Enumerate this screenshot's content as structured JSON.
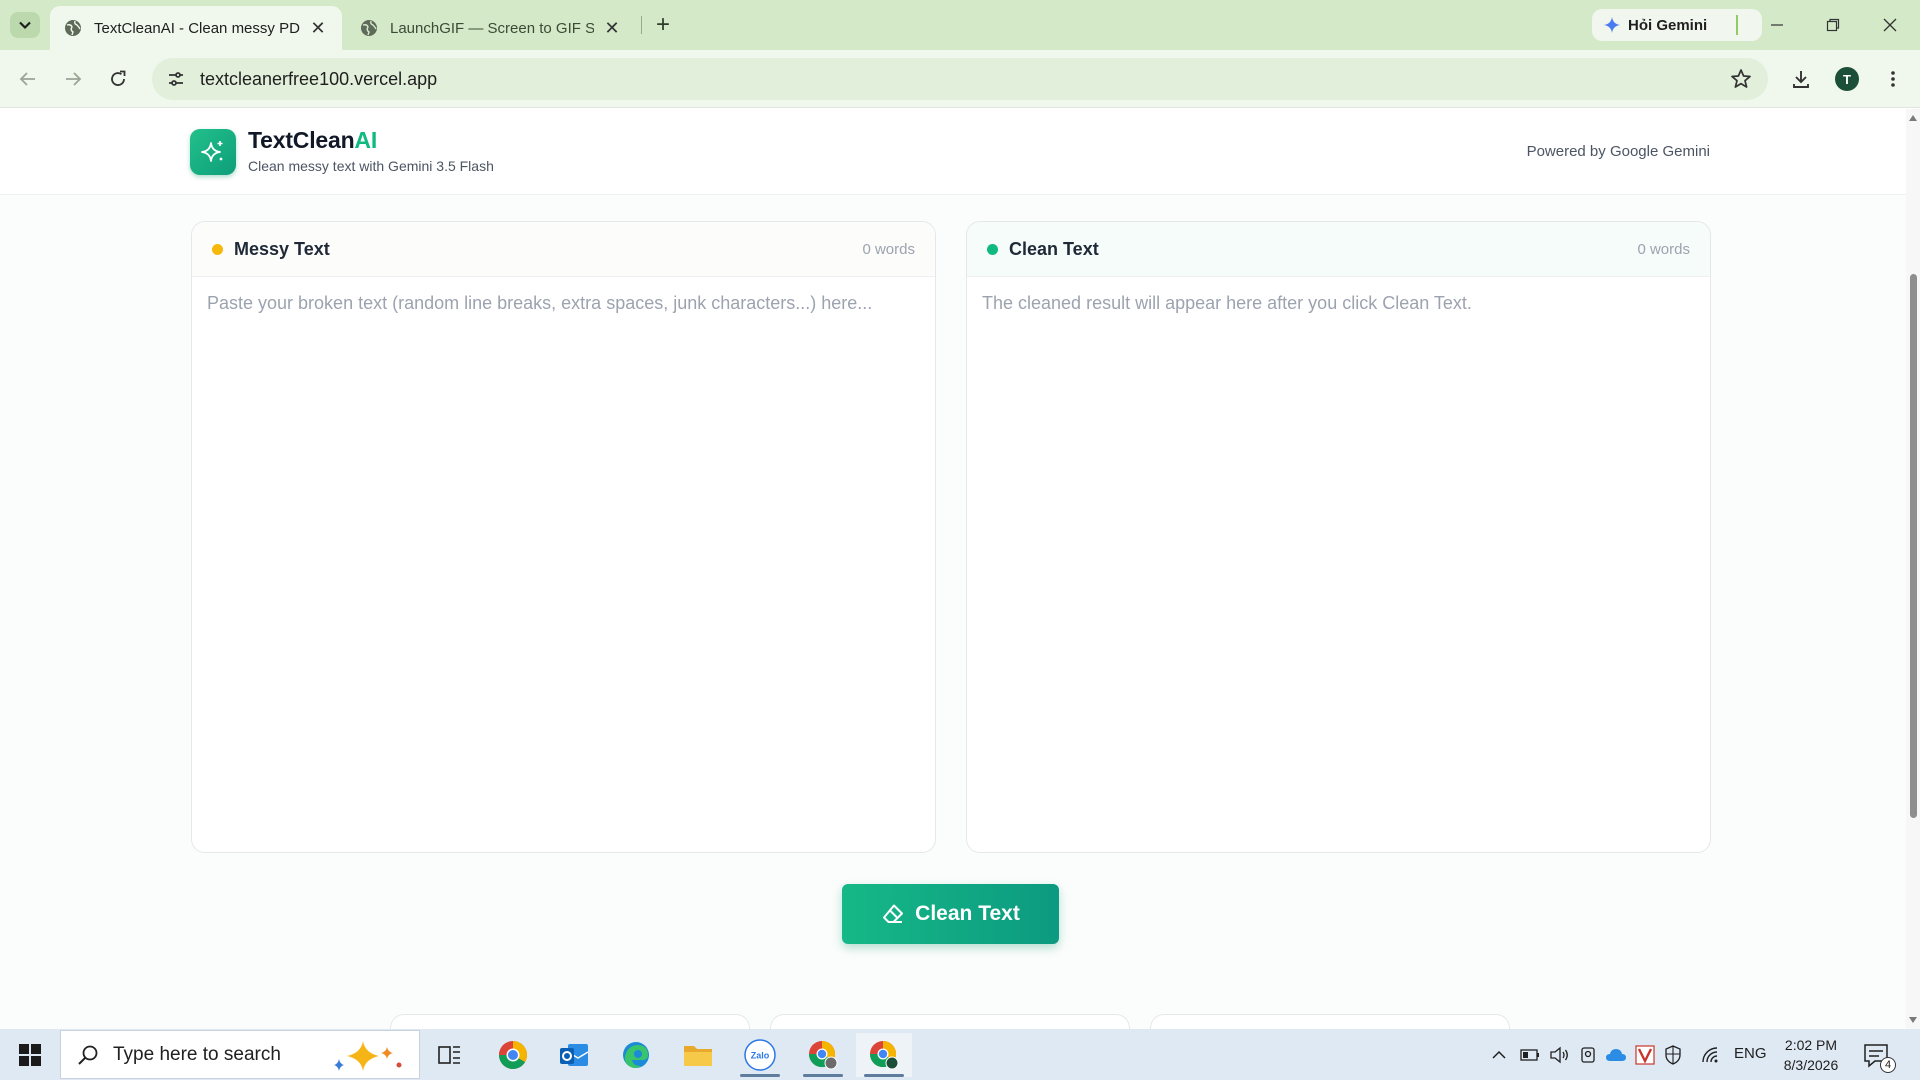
{
  "browser": {
    "tabs": [
      {
        "title": "TextCleanAI - Clean messy PDF",
        "active": true
      },
      {
        "title": "LaunchGIF — Screen to GIF Stu",
        "active": false
      }
    ],
    "gemini_button": "Hỏi Gemini",
    "url": "textcleanerfree100.vercel.app",
    "profile_initial": "T"
  },
  "site": {
    "brand_main": "TextClean",
    "brand_accent": "AI",
    "tagline": "Clean messy text with Gemini 3.5 Flash",
    "powered_by": "Powered by Google Gemini"
  },
  "messy_panel": {
    "title": "Messy Text",
    "word_count": "0 words",
    "placeholder": "Paste your broken text (random line breaks, extra spaces, junk characters...) here...",
    "dot_color": "#f5b80b"
  },
  "clean_panel": {
    "title": "Clean Text",
    "word_count": "0 words",
    "placeholder": "The cleaned result will appear here after you click Clean Text.",
    "dot_color": "#10b981"
  },
  "clean_button": {
    "label": "Clean Text"
  },
  "colors": {
    "accent": "#10b981",
    "tab_bar": "#d3e9c8"
  },
  "taskbar": {
    "search_placeholder": "Type here to search",
    "language": "ENG",
    "time": "2:02 PM",
    "date": "8/3/2026",
    "notification_count": "4"
  }
}
